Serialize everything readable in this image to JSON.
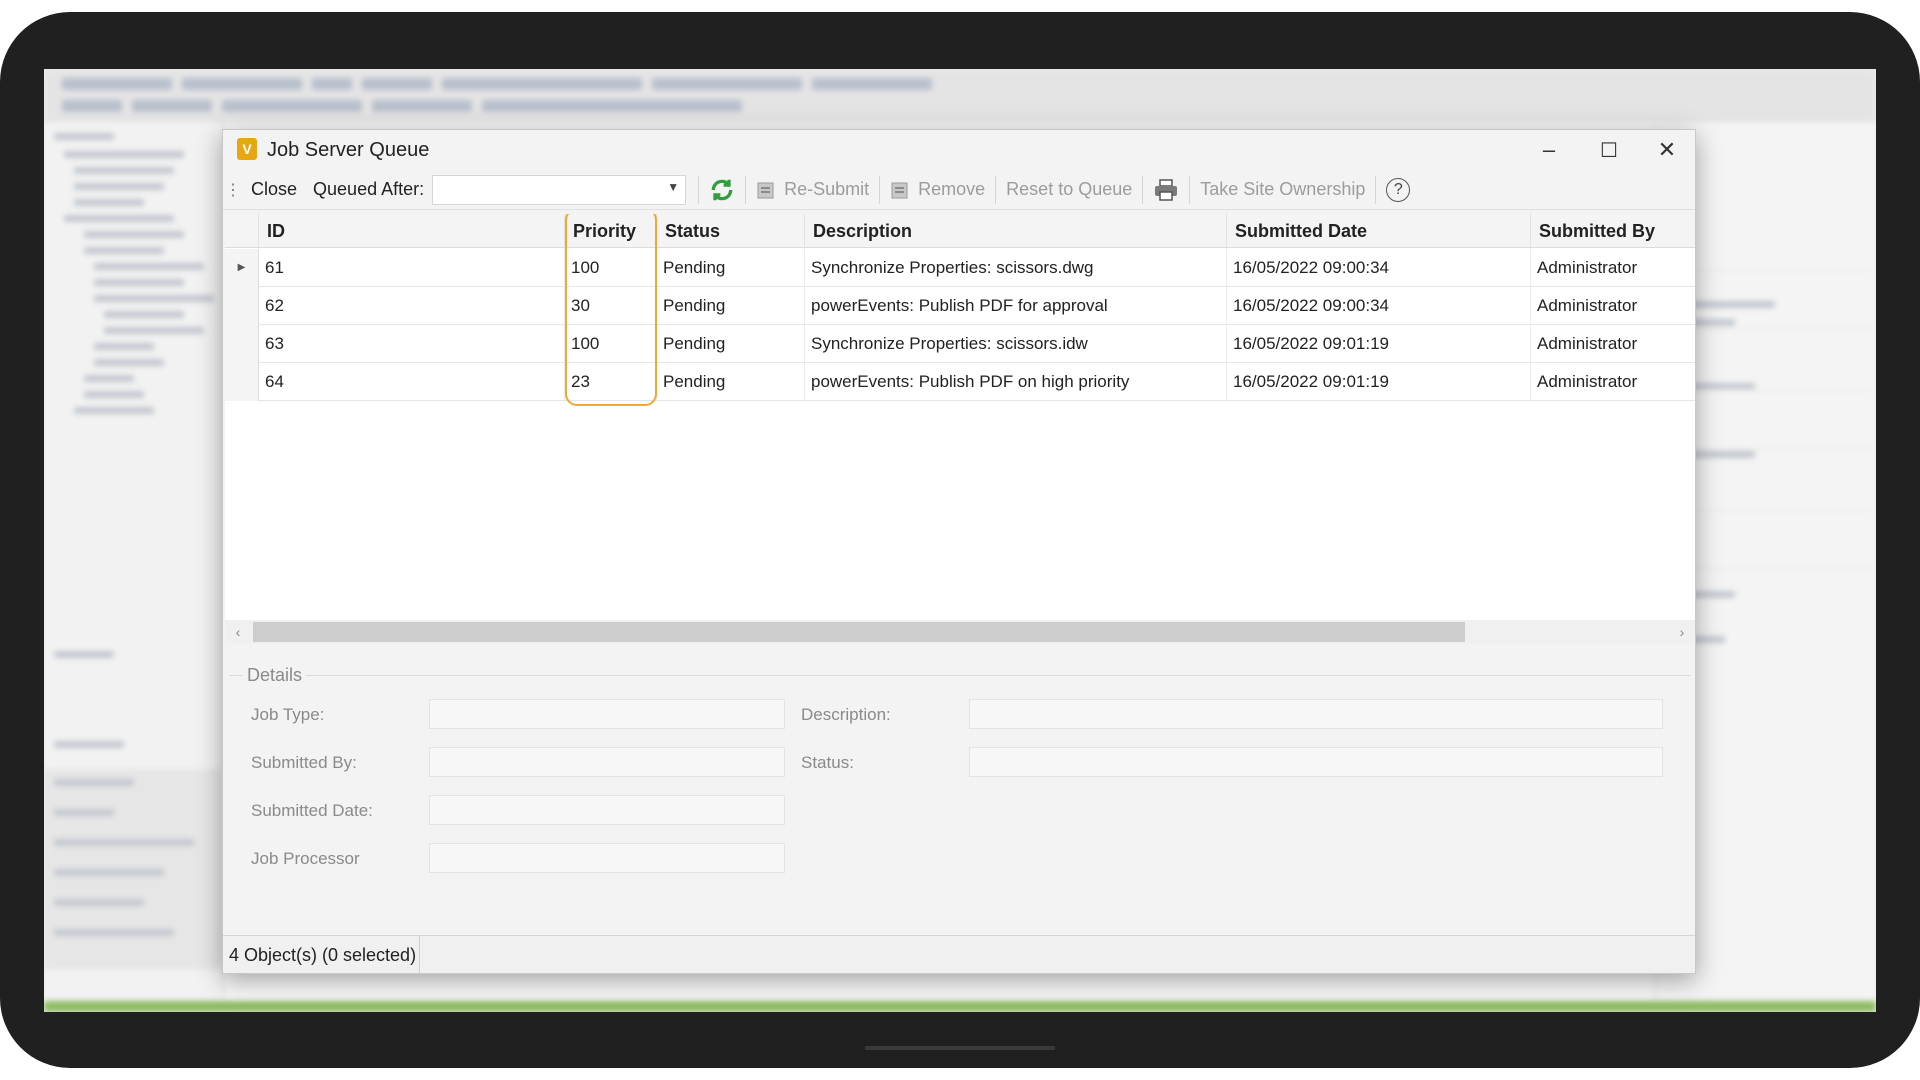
{
  "dialog": {
    "title": "Job Server Queue",
    "icon_letter": "V",
    "controls": {
      "minimize": "–",
      "maximize": "☐",
      "close": "✕"
    }
  },
  "toolbar": {
    "close_label": "Close",
    "queued_after_label": "Queued After:",
    "queued_after_value": "",
    "resubmit_label": "Re-Submit",
    "remove_label": "Remove",
    "reset_label": "Reset to Queue",
    "take_ownership_label": "Take Site Ownership",
    "help_label": "?"
  },
  "grid": {
    "columns": [
      "ID",
      "Priority",
      "Status",
      "Description",
      "Submitted Date",
      "Submitted By"
    ],
    "rows": [
      {
        "id": "61",
        "priority": "100",
        "status": "Pending",
        "description": "Synchronize Properties: scissors.dwg",
        "date": "16/05/2022 09:00:34",
        "by": "Administrator"
      },
      {
        "id": "62",
        "priority": "30",
        "status": "Pending",
        "description": "powerEvents: Publish PDF for approval",
        "date": "16/05/2022 09:00:34",
        "by": "Administrator"
      },
      {
        "id": "63",
        "priority": "100",
        "status": "Pending",
        "description": "Synchronize Properties: scissors.idw",
        "date": "16/05/2022 09:01:19",
        "by": "Administrator"
      },
      {
        "id": "64",
        "priority": "23",
        "status": "Pending",
        "description": "powerEvents: Publish PDF on high priority",
        "date": "16/05/2022 09:01:19",
        "by": "Administrator"
      }
    ]
  },
  "details": {
    "legend": "Details",
    "job_type_label": "Job Type:",
    "description_label": "Description:",
    "submitted_by_label": "Submitted By:",
    "status_label": "Status:",
    "submitted_date_label": "Submitted Date:",
    "job_processor_label": "Job Processor"
  },
  "statusbar": {
    "text": "4 Object(s) (0 selected)"
  },
  "colors": {
    "highlight": "#f0a830",
    "refresh": "#2e9e3f",
    "app_icon": "#e8a612"
  }
}
